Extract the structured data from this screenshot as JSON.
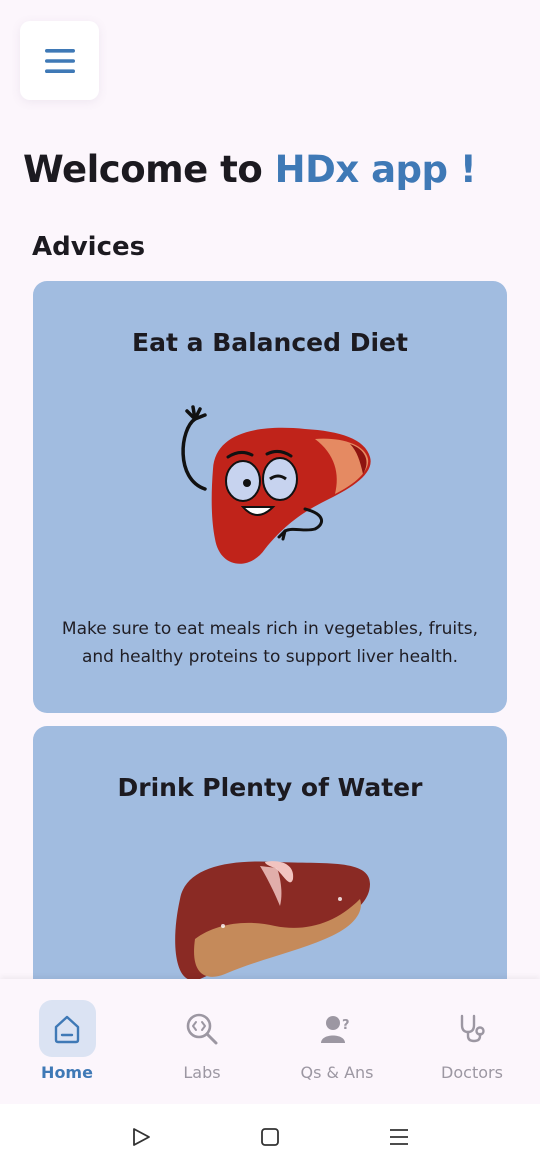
{
  "header": {
    "menu_icon": "hamburger-menu-icon",
    "welcome_prefix": "Welcome to ",
    "welcome_brand": "HDx app !",
    "brand_color": "#3f79b6"
  },
  "advices": {
    "title": "Advices",
    "cards": [
      {
        "title": "Eat a Balanced Diet",
        "illustration": "happy-liver-illustration",
        "description": "Make sure to eat meals rich in vegetables, fruits, and healthy proteins to support liver health."
      },
      {
        "title": "Drink Plenty of Water",
        "illustration": "liver-illustration"
      }
    ],
    "card_color": "#a1bce0"
  },
  "bottom_nav": {
    "items": [
      {
        "label": "Home",
        "icon": "home-icon",
        "active": true
      },
      {
        "label": "Labs",
        "icon": "lab-search-icon",
        "active": false
      },
      {
        "label": "Qs & Ans",
        "icon": "user-question-icon",
        "active": false
      },
      {
        "label": "Doctors",
        "icon": "stethoscope-icon",
        "active": false
      }
    ]
  },
  "system_bar": {
    "back_icon": "back-triangle-icon",
    "home_icon": "home-square-icon",
    "recent_icon": "recent-lines-icon"
  }
}
